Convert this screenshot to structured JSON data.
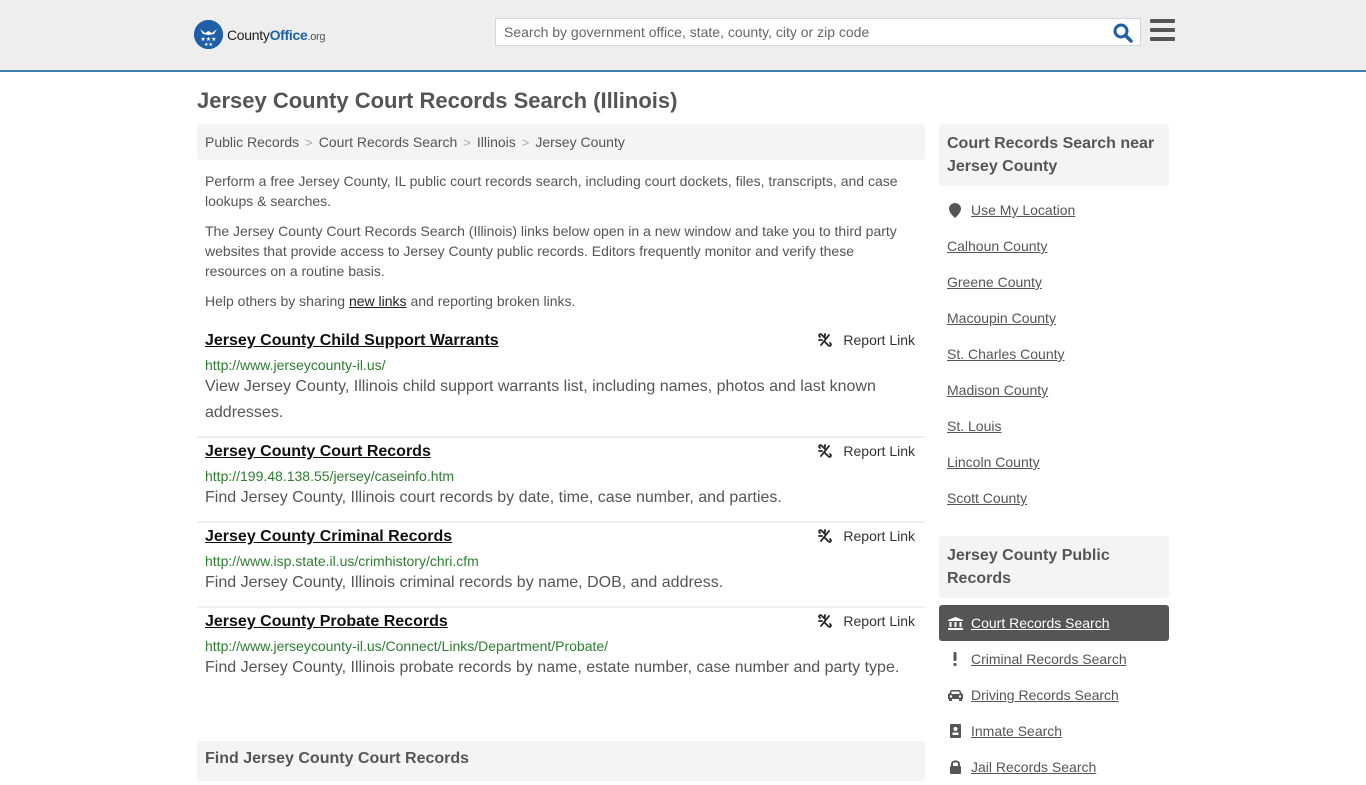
{
  "header": {
    "logo": {
      "brand_main": "County",
      "brand_accent": "Office",
      "brand_tld": ".org"
    },
    "search": {
      "placeholder": "Search by government office, state, county, city or zip code",
      "value": ""
    },
    "search_icon": "magnifier-icon",
    "menu_icon": "hamburger-icon"
  },
  "page": {
    "title": "Jersey County Court Records Search (Illinois)"
  },
  "breadcrumb": [
    {
      "label": "Public Records"
    },
    {
      "label": "Court Records Search"
    },
    {
      "label": "Illinois"
    },
    {
      "label": "Jersey County"
    }
  ],
  "breadcrumb_separator": ">",
  "intro": {
    "p1": "Perform a free Jersey County, IL public court records search, including court dockets, files, transcripts, and case lookups & searches.",
    "p2": "The Jersey County Court Records Search (Illinois) links below open in a new window and take you to third party websites that provide access to Jersey County public records. Editors frequently monitor and verify these resources on a routine basis.",
    "p3_before": "Help others by sharing ",
    "p3_link": "new links",
    "p3_after": " and reporting broken links."
  },
  "results": [
    {
      "title": "Jersey County Child Support Warrants",
      "url": "http://www.jerseycounty-il.us/",
      "description": "View Jersey County, Illinois child support warrants list, including names, photos and last known addresses.",
      "report_label": "Report Link"
    },
    {
      "title": "Jersey County Court Records",
      "url": "http://199.48.138.55/jersey/caseinfo.htm",
      "description": "Find Jersey County, Illinois court records by date, time, case number, and parties.",
      "report_label": "Report Link"
    },
    {
      "title": "Jersey County Criminal Records",
      "url": "http://www.isp.state.il.us/crimhistory/chri.cfm",
      "description": "Find Jersey County, Illinois criminal records by name, DOB, and address.",
      "report_label": "Report Link"
    },
    {
      "title": "Jersey County Probate Records",
      "url": "http://www.jerseycounty-il.us/Connect/Links/Department/Probate/",
      "description": "Find Jersey County, Illinois probate records by name, estate number, case number and party type.",
      "report_label": "Report Link"
    }
  ],
  "find_section": {
    "title": "Find Jersey County Court Records"
  },
  "sidebar": {
    "nearby": {
      "title": "Court Records Search near Jersey County",
      "use_location": "Use My Location",
      "items": [
        {
          "label": "Calhoun County"
        },
        {
          "label": "Greene County"
        },
        {
          "label": "Macoupin County"
        },
        {
          "label": "St. Charles County"
        },
        {
          "label": "Madison County"
        },
        {
          "label": "St. Louis"
        },
        {
          "label": "Lincoln County"
        },
        {
          "label": "Scott County"
        }
      ]
    },
    "public_records": {
      "title": "Jersey County Public Records",
      "items": [
        {
          "label": "Court Records Search",
          "icon": "courthouse-icon",
          "active": true
        },
        {
          "label": "Criminal Records Search",
          "icon": "exclamation-icon",
          "active": false
        },
        {
          "label": "Driving Records Search",
          "icon": "car-icon",
          "active": false
        },
        {
          "label": "Inmate Search",
          "icon": "id-badge-icon",
          "active": false
        },
        {
          "label": "Jail Records Search",
          "icon": "lock-icon",
          "active": false
        }
      ]
    }
  },
  "colors": {
    "header_bg": "#eeeeee",
    "header_border": "#3d7fb0",
    "brand_blue": "#1f5fa6",
    "url_green": "#2e7d32",
    "active_item_bg": "#555555",
    "box_bg": "#f4f4f4"
  }
}
